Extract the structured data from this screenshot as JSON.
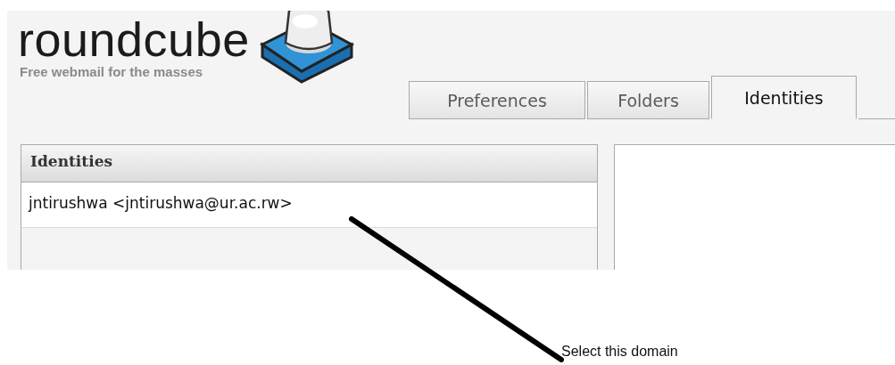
{
  "logo": {
    "name": "roundcube",
    "tagline": "Free webmail for the masses"
  },
  "tabs": [
    {
      "label": "Preferences",
      "selected": false
    },
    {
      "label": "Folders",
      "selected": false
    },
    {
      "label": "Identities",
      "selected": true
    }
  ],
  "identities_panel": {
    "title": "Identities",
    "rows": [
      {
        "text": "jntirushwa <jntirushwa@ur.ac.rw>"
      }
    ]
  },
  "annotation": {
    "label": "Select this domain"
  }
}
